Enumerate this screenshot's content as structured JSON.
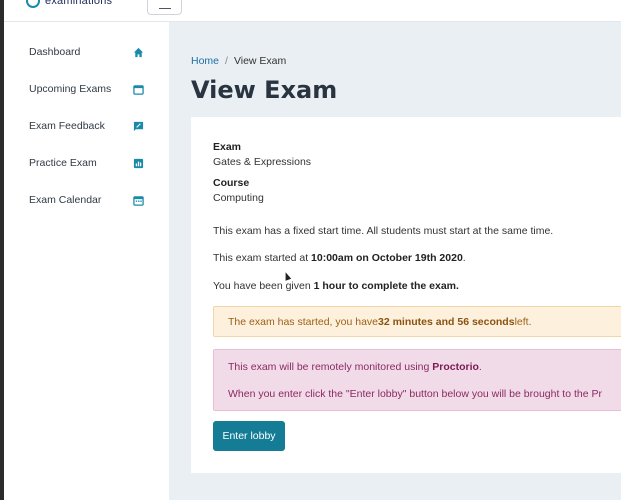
{
  "header": {
    "logo_text": "examinations"
  },
  "sidebar": {
    "items": [
      {
        "label": "Dashboard",
        "icon": "home-icon"
      },
      {
        "label": "Upcoming Exams",
        "icon": "calendar-icon"
      },
      {
        "label": "Exam Feedback",
        "icon": "feedback-icon"
      },
      {
        "label": "Practice Exam",
        "icon": "chart-icon"
      },
      {
        "label": "Exam Calendar",
        "icon": "calendar-grid-icon"
      }
    ],
    "icon_color": "#1a8aa8"
  },
  "breadcrumb": {
    "home": "Home",
    "separator": "/",
    "current": "View Exam"
  },
  "page": {
    "title": "View Exam"
  },
  "exam": {
    "exam_label": "Exam",
    "exam_value": "Gates & Expressions",
    "course_label": "Course",
    "course_value": "Computing",
    "fixed_start_text": "This exam has a fixed start time. All students must start at the same time.",
    "started_prefix": "This exam started at ",
    "started_time": "10:00am on October 19th 2020",
    "started_suffix": ".",
    "given_prefix": "You have been given ",
    "given_duration": "1 hour to complete the exam."
  },
  "warning_alert": {
    "prefix": "The exam has started, you have ",
    "time_left": "32 minutes and 56 seconds",
    "suffix": " left."
  },
  "info_alert": {
    "line1_prefix": "This exam will be remotely monitored using ",
    "line1_brand": "Proctorio",
    "line1_suffix": ".",
    "line2": "When you enter click the \"Enter lobby\" button below you will be brought to the Pr"
  },
  "actions": {
    "enter_lobby": "Enter lobby",
    "accent_color": "#157c96"
  }
}
